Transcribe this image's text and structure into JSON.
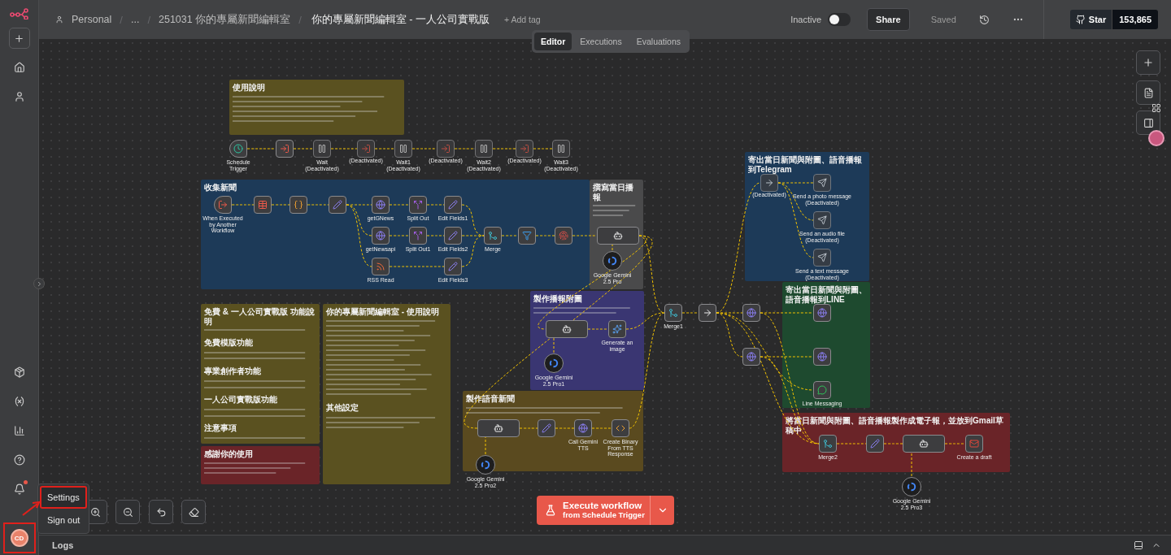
{
  "header": {
    "breadcrumbs": [
      {
        "label": "Personal",
        "kind": "project"
      },
      {
        "label": "/",
        "kind": "separator"
      },
      {
        "label": "...",
        "kind": "ellipsis"
      },
      {
        "label": "/",
        "kind": "separator"
      },
      {
        "label": "251031 你的專屬新聞編輯室",
        "kind": "folder"
      },
      {
        "label": "/",
        "kind": "separator"
      }
    ],
    "title": "你的專屬新聞編輯室 - 一人公司實戰版",
    "add_tag": "+ Add tag",
    "active": {
      "label": "Inactive",
      "on": false
    },
    "share": "Share",
    "saved": "Saved",
    "github": {
      "label": "Star",
      "count": "153,865"
    }
  },
  "view_tabs": [
    {
      "label": "Editor",
      "selected": true
    },
    {
      "label": "Executions",
      "selected": false
    },
    {
      "label": "Evaluations",
      "selected": false
    }
  ],
  "notes": [
    {
      "title": "使用說明",
      "color": "#5a5120"
    },
    {
      "title": "寄出當日新聞與附圖、語音播報到Telegram",
      "color": "#1d3a58"
    },
    {
      "title": "收集新聞",
      "color": "#1d3a58"
    },
    {
      "title": "撰寫當日播報",
      "color": "#4a4a4b"
    },
    {
      "title": "製作播報附圖",
      "color": "#3a3672"
    },
    {
      "title": "寄出當日新聞與附圖、語音播報到LINE",
      "color": "#1e4a2f"
    },
    {
      "title": "免費 & 一人公司實戰版 功能說明",
      "color": "#5a5120",
      "headings": [
        "免費模版功能",
        "專業創作者功能",
        "一人公司實戰版功能",
        "注意事項"
      ]
    },
    {
      "title": "你的專屬新聞編輯室 - 使用說明",
      "color": "#5a5120",
      "headings": [
        "其他設定"
      ]
    },
    {
      "title": "製作語音新聞",
      "color": "#5a4a1f"
    },
    {
      "title": "將當日新聞與附圖、語音播報製作成電子報，並放到Gmail草稿中",
      "color": "#6a2428"
    },
    {
      "title": "感謝你的使用",
      "color": "#6a2428"
    }
  ],
  "nodes": [
    {
      "label": "Schedule Trigger",
      "kind": "clock"
    },
    {
      "kind": "execute"
    },
    {
      "label": "Wait",
      "status": "(Deactivated)",
      "kind": "pause"
    },
    {
      "status": "(Deactivated)",
      "kind": "execute"
    },
    {
      "label": "Wait1",
      "status": "(Deactivated)",
      "kind": "pause"
    },
    {
      "status": "(Deactivated)",
      "kind": "execute"
    },
    {
      "label": "Wait2",
      "status": "(Deactivated)",
      "kind": "pause"
    },
    {
      "status": "(Deactivated)",
      "kind": "execute"
    },
    {
      "label": "Wait3",
      "status": "(Deactivated)",
      "kind": "pause"
    },
    {
      "label": "When Executed by Another Workflow",
      "kind": "subtrigger"
    },
    {
      "kind": "table"
    },
    {
      "kind": "code"
    },
    {
      "kind": "pen"
    },
    {
      "label": "getGNews",
      "kind": "globe"
    },
    {
      "label": "Split Out",
      "kind": "split"
    },
    {
      "label": "Edit Fields1",
      "kind": "pen"
    },
    {
      "label": "getNewsapi",
      "kind": "globe"
    },
    {
      "label": "Split Out1",
      "kind": "split"
    },
    {
      "label": "Edit Fields2",
      "kind": "pen"
    },
    {
      "label": "RSS Read",
      "kind": "rss"
    },
    {
      "label": "Edit Fields3",
      "kind": "pen"
    },
    {
      "label": "Merge",
      "kind": "merge"
    },
    {
      "kind": "filter"
    },
    {
      "kind": "dedupe"
    },
    {
      "kind": "agent"
    },
    {
      "label": "Google Gemini 2.5 Pro",
      "kind": "model"
    },
    {
      "kind": "agent"
    },
    {
      "label": "Generate an image",
      "kind": "gemini"
    },
    {
      "label": "Google Gemini 2.5 Pro1",
      "kind": "model"
    },
    {
      "kind": "agent"
    },
    {
      "kind": "pen"
    },
    {
      "label": "Call Gemini TTS",
      "kind": "globe"
    },
    {
      "label": "Create Binary From TTS Response",
      "kind": "codetag"
    },
    {
      "label": "Google Gemini 2.5 Pro2",
      "kind": "model"
    },
    {
      "label": "Merge1",
      "kind": "merge"
    },
    {
      "kind": "arrow"
    },
    {
      "kind": "globe"
    },
    {
      "kind": "globe"
    },
    {
      "status": "(Deactivated)",
      "kind": "arrow"
    },
    {
      "label": "Send a photo message",
      "status": "(Deactivated)",
      "kind": "send"
    },
    {
      "label": "Send an audio file",
      "status": "(Deactivated)",
      "kind": "send"
    },
    {
      "label": "Send a text message",
      "status": "(Deactivated)",
      "kind": "send"
    },
    {
      "kind": "globe"
    },
    {
      "kind": "globe"
    },
    {
      "label": "Line Messaging",
      "kind": "line"
    },
    {
      "label": "Merge2",
      "kind": "merge"
    },
    {
      "kind": "pen"
    },
    {
      "kind": "agent"
    },
    {
      "label": "Create a draft",
      "kind": "gmail"
    },
    {
      "label": "Google Gemini 2.5 Pro3",
      "kind": "model"
    }
  ],
  "execute": {
    "label": "Execute workflow",
    "sublabel": "from Schedule Trigger"
  },
  "user_menu": {
    "avatar": {
      "initials": "CD",
      "highlighted": true
    },
    "items": [
      {
        "label": "Settings",
        "highlighted": true
      },
      {
        "label": "Sign out",
        "highlighted": false
      }
    ]
  },
  "logs": {
    "label": "Logs"
  }
}
